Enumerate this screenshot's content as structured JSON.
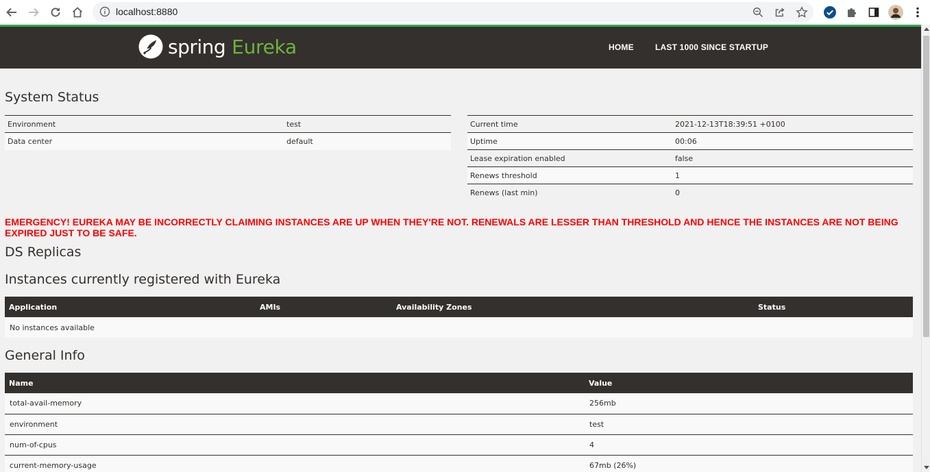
{
  "browser": {
    "url": "localhost:8880",
    "icons": [
      "back-icon",
      "forward-icon",
      "reload-icon",
      "home-icon",
      "info-icon",
      "zoom-icon",
      "share-icon",
      "star-icon",
      "extension-check-icon",
      "puzzle-icon",
      "sidepanel-icon",
      "avatar",
      "menu-icon"
    ]
  },
  "navbar": {
    "brand_spring": "spring",
    "brand_eureka": "Eureka",
    "links": [
      "HOME",
      "LAST 1000 SINCE STARTUP"
    ]
  },
  "system_status": {
    "title": "System Status",
    "left": [
      {
        "label": "Environment",
        "value": "test"
      },
      {
        "label": "Data center",
        "value": "default"
      }
    ],
    "right": [
      {
        "label": "Current time",
        "value": "2021-12-13T18:39:51 +0100"
      },
      {
        "label": "Uptime",
        "value": "00:06"
      },
      {
        "label": "Lease expiration enabled",
        "value": "false"
      },
      {
        "label": "Renews threshold",
        "value": "1"
      },
      {
        "label": "Renews (last min)",
        "value": "0"
      }
    ]
  },
  "emergency": "EMERGENCY! EUREKA MAY BE INCORRECTLY CLAIMING INSTANCES ARE UP WHEN THEY'RE NOT. RENEWALS ARE LESSER THAN THRESHOLD AND HENCE THE INSTANCES ARE NOT BEING EXPIRED JUST TO BE SAFE.",
  "ds_replicas": {
    "title": "DS Replicas"
  },
  "instances": {
    "title": "Instances currently registered with Eureka",
    "columns": [
      "Application",
      "AMIs",
      "Availability Zones",
      "Status"
    ],
    "empty": "No instances available"
  },
  "general_info": {
    "title": "General Info",
    "columns": [
      "Name",
      "Value"
    ],
    "rows": [
      {
        "name": "total-avail-memory",
        "value": "256mb"
      },
      {
        "name": "environment",
        "value": "test"
      },
      {
        "name": "num-of-cpus",
        "value": "4"
      },
      {
        "name": "current-memory-usage",
        "value": "67mb (26%)"
      }
    ]
  },
  "colors": {
    "navbar": "#34302d",
    "spring_green": "#6db33f",
    "emergency_red": "#ff0000",
    "page_bg": "#f1f1f1"
  }
}
